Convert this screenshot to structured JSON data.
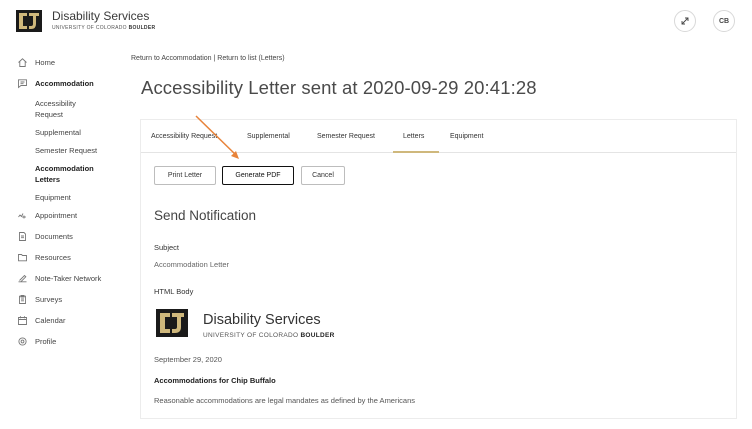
{
  "header": {
    "brand_name": "Disability Services",
    "brand_sub_plain": "UNIVERSITY OF COLORADO",
    "brand_sub_bold": "BOULDER",
    "tool_icon": "link-tool-icon",
    "avatar_initials": "CB"
  },
  "sidebar": {
    "items": [
      {
        "label": "Home",
        "icon": "home-icon"
      },
      {
        "label": "Accommodation",
        "icon": "chat-icon"
      },
      {
        "label": "Appointment",
        "icon": "clock-icon"
      },
      {
        "label": "Documents",
        "icon": "document-icon"
      },
      {
        "label": "Resources",
        "icon": "folder-icon"
      },
      {
        "label": "Note-Taker Network",
        "icon": "pencil-icon"
      },
      {
        "label": "Surveys",
        "icon": "clipboard-icon"
      },
      {
        "label": "Calendar",
        "icon": "calendar-icon"
      },
      {
        "label": "Profile",
        "icon": "gear-icon"
      }
    ],
    "sub_items": [
      {
        "line1": "Accessibility",
        "line2": "Request"
      },
      {
        "line1": "Supplemental"
      },
      {
        "line1": "Semester Request"
      },
      {
        "line1": "Accommodation",
        "line2": "Letters"
      },
      {
        "line1": "Equipment"
      }
    ]
  },
  "breadcrumb": {
    "link1": "Return to Accommodation",
    "separator": " | ",
    "link2": "Return to list (Letters)"
  },
  "page_title": "Accessibility Letter sent at 2020-09-29 20:41:28",
  "tabs": [
    {
      "label": "Accessibility Request"
    },
    {
      "label": "Supplemental"
    },
    {
      "label": "Semester Request"
    },
    {
      "label": "Letters"
    },
    {
      "label": "Equipment"
    }
  ],
  "active_tab": "Letters",
  "buttons": {
    "print": "Print Letter",
    "generate": "Generate PDF",
    "cancel": "Cancel"
  },
  "notification": {
    "title": "Send Notification",
    "subject_label": "Subject",
    "subject_value": "Accommodation Letter",
    "body_label": "HTML Body",
    "body_brand": "Disability Services",
    "body_brand_sub_plain": "UNIVERSITY OF COLORADO",
    "body_brand_sub_bold": "BOULDER",
    "date": "September 29, 2020",
    "heading": "Accommodations for Chip Buffalo",
    "paragraph": "Reasonable accommodations are legal mandates as defined by the Americans"
  },
  "colors": {
    "accent_gold": "#cfb87c",
    "arrow": "#e8833a",
    "text_dark": "#333333"
  }
}
